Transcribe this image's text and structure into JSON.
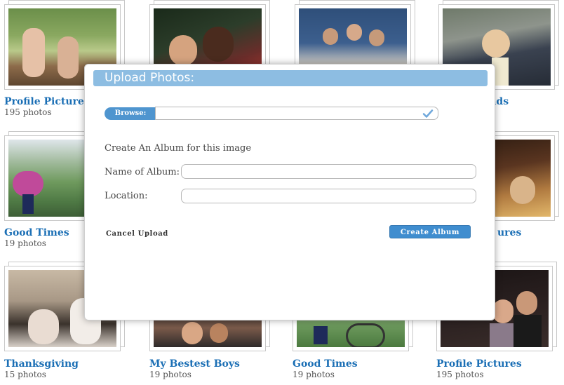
{
  "albums": [
    {
      "title": "Profile Pictures",
      "count": "195 photos"
    },
    {
      "title": "",
      "count": ""
    },
    {
      "title": "",
      "count": ""
    },
    {
      "title": "oads",
      "count": ""
    },
    {
      "title": "Good Times",
      "count": "19 photos"
    },
    {
      "title": "ures",
      "count": ""
    },
    {
      "title": "Thanksgiving",
      "count": "15 photos"
    },
    {
      "title": "My Bestest Boys",
      "count": "19 photos"
    },
    {
      "title": "Good Times",
      "count": "19 photos"
    },
    {
      "title": "Profile Pictures",
      "count": "195 photos"
    }
  ],
  "modal": {
    "title": "Upload Photos:",
    "browse_label": "Browse:",
    "section_label": "Create An Album for this image",
    "album_name_label": "Name of Album:",
    "album_name_value": "",
    "location_label": "Location:",
    "location_value": "",
    "cancel_label": "Cancel Upload",
    "create_label": "Create Album"
  },
  "colors": {
    "accent": "#3f8dcf",
    "header": "#8dbde2",
    "link": "#1b6fb5"
  }
}
